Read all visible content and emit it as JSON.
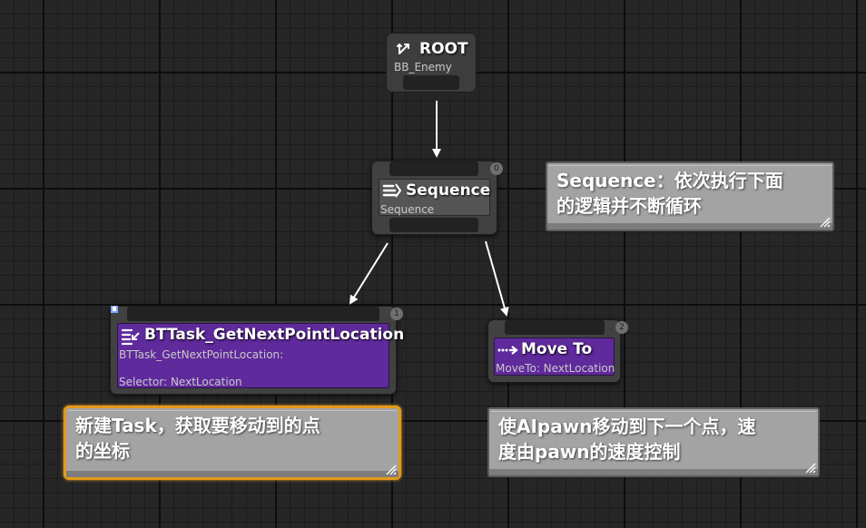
{
  "graph": {
    "root": {
      "title": "ROOT",
      "subtitle": "BB_Enemy",
      "icon": "root-branch-icon"
    },
    "sequence": {
      "title": "Sequence",
      "subtitle": "Sequence",
      "order": "0",
      "icon": "sequence-icon"
    },
    "task_get_next_point": {
      "title": "BTTask_GetNextPointLocation",
      "subtitle": "BTTask_GetNextPointLocation:",
      "detail": "Selector: NextLocation",
      "order": "1",
      "icon": "task-icon",
      "breakpoint_icon": "blueprint-marker-icon"
    },
    "move_to": {
      "title": "Move To",
      "subtitle": "MoveTo: NextLocation",
      "order": "2",
      "icon": "move-to-icon"
    }
  },
  "comments": {
    "sequence_note": {
      "text": "Sequence：依次执行下面\n的逻辑并不断循环"
    },
    "task_note": {
      "text": "新建Task，获取要移动到的点\n的坐标",
      "selected": true
    },
    "move_note": {
      "text": "使AIpawn移动到下一个点，速\n度由pawn的速度控制"
    }
  },
  "colors": {
    "canvas": "#262626",
    "task_node": "#5f2a9b",
    "composite_node": "#555555",
    "comment": "#a3a3a3",
    "selection": "#e39a1c",
    "link": "#ffffff"
  }
}
